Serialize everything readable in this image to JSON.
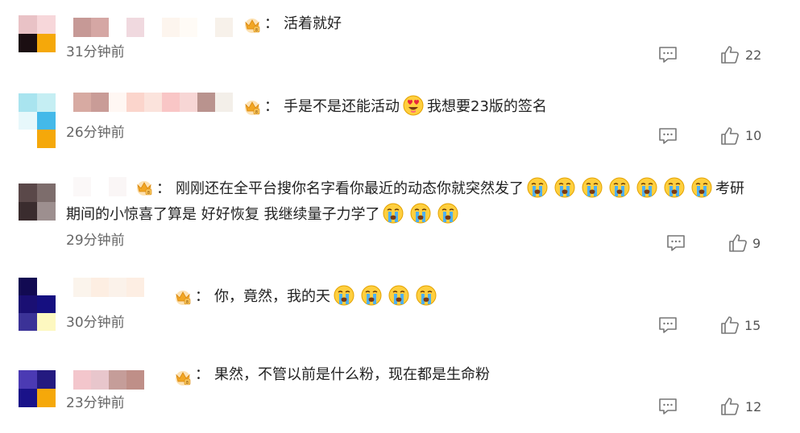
{
  "comments": [
    {
      "text": "活着就好",
      "time": "31分钟前",
      "likes": "22",
      "separator": "："
    },
    {
      "text_before": "手是不是还能活动",
      "text_after": "我想要23版的签名",
      "time": "26分钟前",
      "likes": "10",
      "separator": "：",
      "emoji_name": "heart-eyes-emoji"
    },
    {
      "line1": "刚刚还在全平台搜你名字看你最近的动态你就突然发了",
      "line1_end": "考研",
      "line2": "期间的小惊喜了算是 好好恢复 我继续量子力学了",
      "time": "29分钟前",
      "likes": "9",
      "separator": "：",
      "emoji_name": "crying-emoji"
    },
    {
      "text": "你，竟然，我的天",
      "time": "30分钟前",
      "likes": "15",
      "separator": "：",
      "emoji_name": "crying-emoji"
    },
    {
      "text": "果然，不管以前是什么粉，现在都是生命粉",
      "time": "23分钟前",
      "likes": "12",
      "separator": "："
    }
  ],
  "icons": {
    "reply": "comment-bubble-icon",
    "like": "thumbs-up-icon",
    "badge": "crown-badge-icon"
  },
  "colors": {
    "text": "#222222",
    "meta": "#666666",
    "crown": "#f2a623"
  }
}
